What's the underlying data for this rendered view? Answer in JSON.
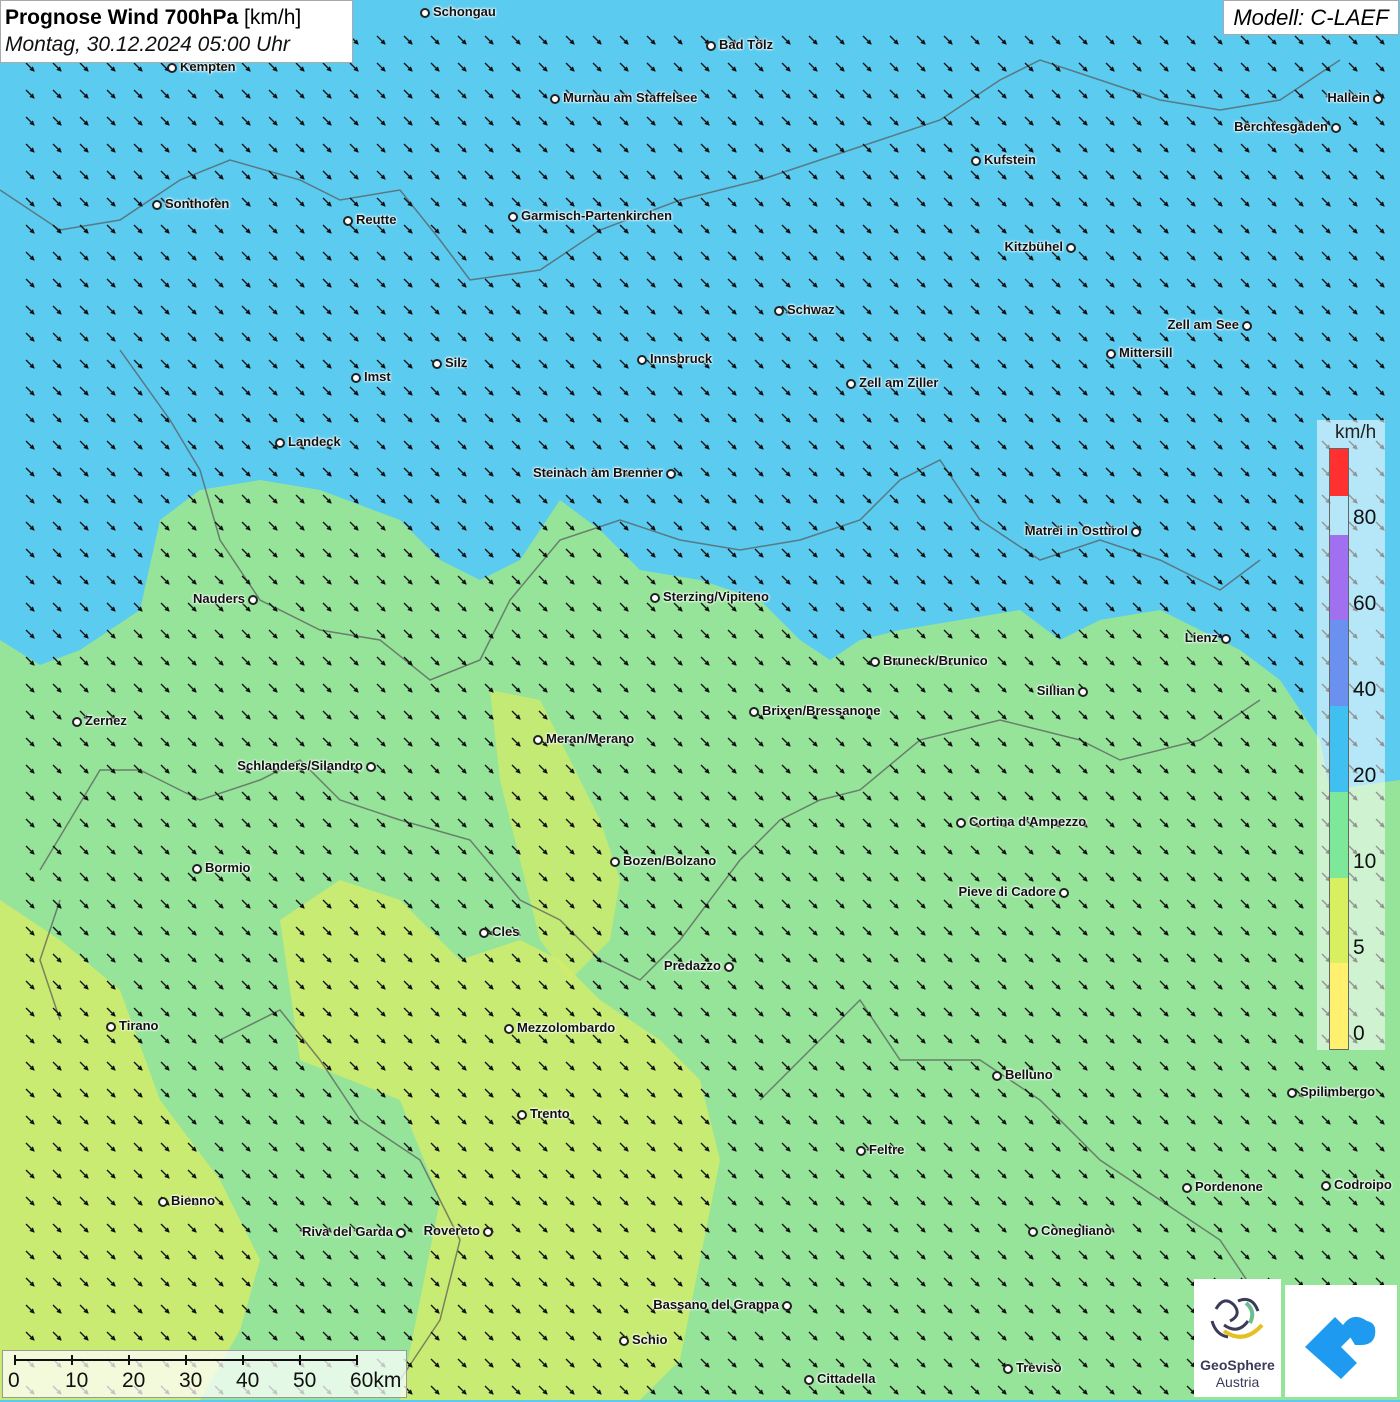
{
  "title": {
    "main": "Prognose Wind 700hPa",
    "unit": "[km/h]",
    "date": "Montag, 30.12.2024 05:00 Uhr"
  },
  "model": "Modell: C-LAEF",
  "legend": {
    "unit": "km/h",
    "labels": [
      "80",
      "60",
      "40",
      "20",
      "10",
      "5",
      "0"
    ],
    "colors": [
      "#ff3030",
      "#a070f0",
      "#6a90f0",
      "#3fc0f0",
      "#7ee89a",
      "#d8f060",
      "#fff070"
    ]
  },
  "scale": {
    "labels": [
      "0",
      "10",
      "20",
      "30",
      "40",
      "50",
      "60km"
    ]
  },
  "logo": {
    "line1": "GeoSphere",
    "line2": "Austria"
  },
  "colors": {
    "north_wind": "#5ccbf0",
    "south_wind": "#95e49a",
    "calm": "#d4ec6a",
    "arrows": "#111111",
    "borders": "#555555"
  },
  "cities": [
    "Schongau",
    "Bad Tölz",
    "Kempten",
    "Murnau am Staffelsee",
    "Hallein",
    "Berchtesgaden",
    "Kufstein",
    "Sonthofen",
    "Reutte",
    "Garmisch-Partenkirchen",
    "Kitzbühel",
    "Schwaz",
    "Zell am See",
    "Mittersill",
    "Innsbruck",
    "Silz",
    "Imst",
    "Zell am Ziller",
    "Landeck",
    "Steinach am Brenner",
    "Matrei in Osttirol",
    "Nauders",
    "Sterzing/Vipiteno",
    "Lienz",
    "Bruneck/Brunico",
    "Sillian",
    "Zernez",
    "Brixen/Bressanone",
    "Meran/Merano",
    "Schlanders/Silandro",
    "Cortina d'Ampezzo",
    "Bozen/Bolzano",
    "Bormio",
    "Pieve di Cadore",
    "Cles",
    "Predazzo",
    "Tirano",
    "Mezzolombardo",
    "Belluno",
    "Spilimbergo",
    "Trento",
    "Feltre",
    "Pordenone",
    "Codroipo",
    "Bienno",
    "Riva del Garda",
    "Rovereto",
    "Conegliano",
    "Bassano del Grappa",
    "Schio",
    "Treviso",
    "Cittadella"
  ]
}
